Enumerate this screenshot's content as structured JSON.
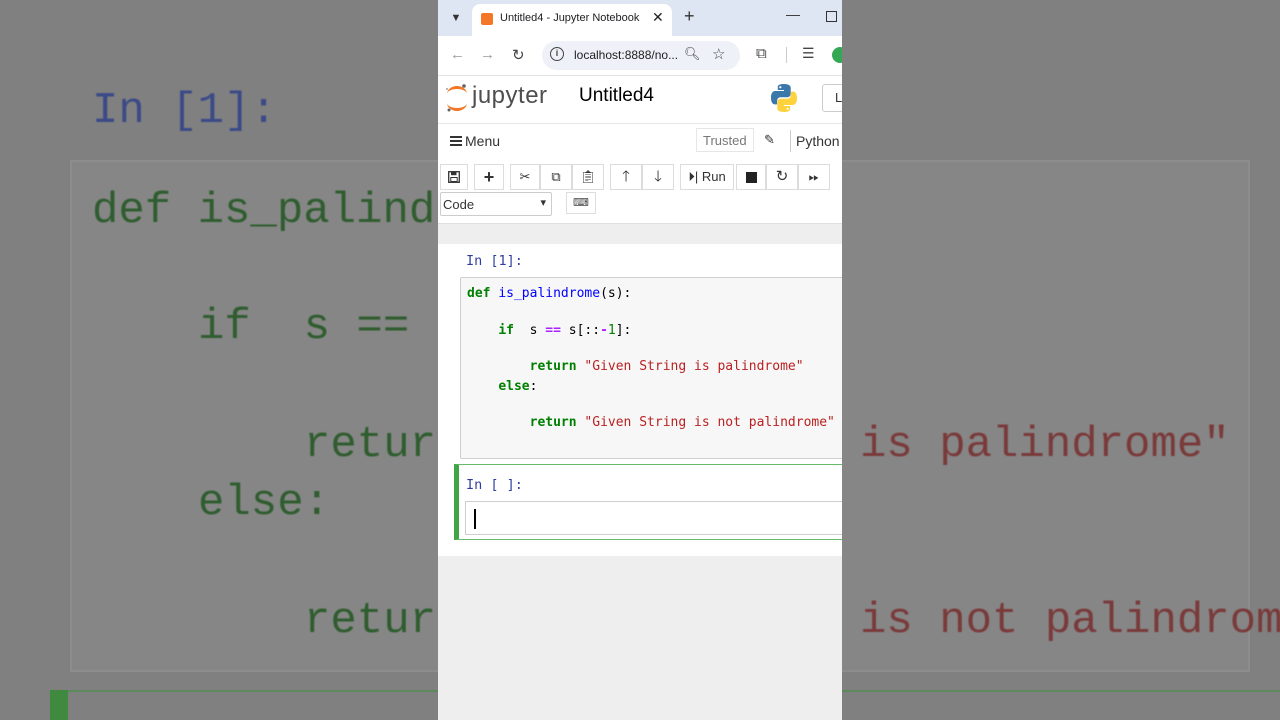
{
  "browser": {
    "tab_title": "Untitled4 - Jupyter Notebook",
    "tab_close": "✕",
    "new_tab": "+",
    "url": "localhost:8888/no...",
    "icons": [
      "chevron-down-icon",
      "jupyter-favicon",
      "back-icon",
      "forward-icon",
      "reload-icon",
      "info-icon",
      "zoom-icon",
      "star-icon",
      "extensions-icon",
      "media-icon",
      "profile-icon"
    ]
  },
  "header": {
    "brand": "jupyter",
    "notebook_name": "Untitled4",
    "logout_label": "L"
  },
  "menubar": {
    "menu_label": "Menu",
    "trusted_label": "Trusted",
    "kernel_label": "Python"
  },
  "toolbar": {
    "run_label": "Run",
    "cell_type": "Code"
  },
  "cells": [
    {
      "prompt": "In [1]:",
      "code": [
        "def is_palindrome(s):",
        "",
        "    if  s == s[::-1]:",
        "",
        "        return \"Given String is palindrome\"",
        "    else:",
        "",
        "        return \"Given String is not palindrome\""
      ]
    },
    {
      "prompt": "In [ ]:",
      "code": [
        ""
      ]
    }
  ],
  "backdrop": {
    "prompt": "In [1]:",
    "lines": [
      "def is_palind",
      "if  s ==",
      "retur",
      "else:",
      "retur"
    ],
    "right_line_1": "is palindrome\"",
    "right_line_2": "is not palindrom"
  },
  "colors": {
    "accent_orange": "#f37726",
    "selected_cell_border": "#42a545",
    "prompt_blue": "#303f9f",
    "keyword_green": "#008000",
    "string_red": "#ba2121"
  }
}
